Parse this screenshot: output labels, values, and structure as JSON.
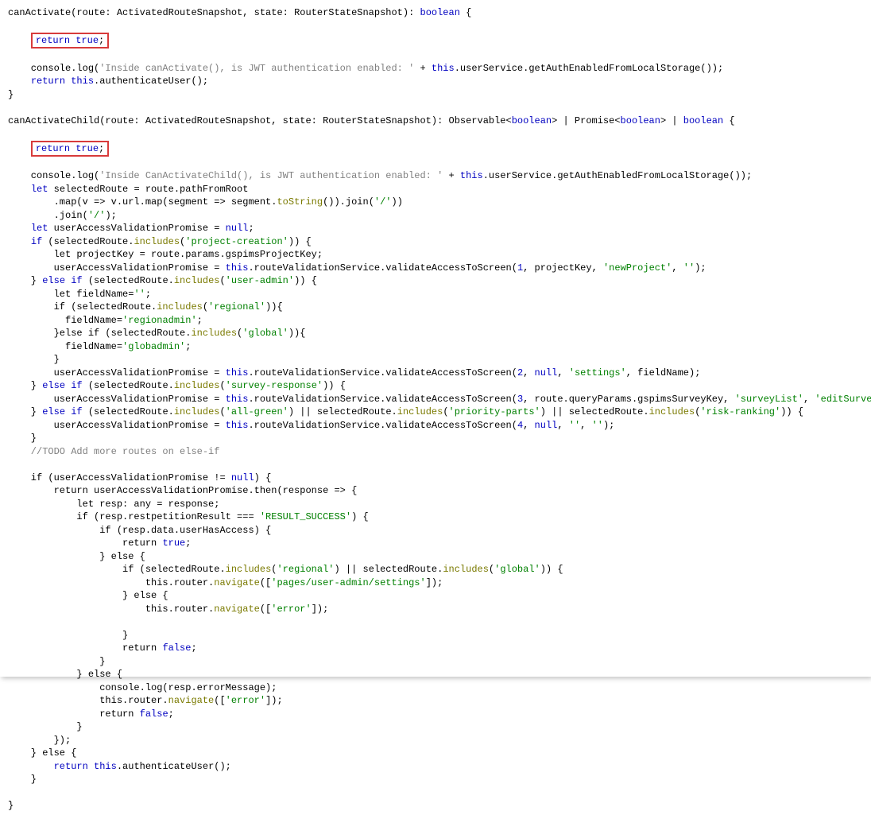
{
  "code": {
    "fn_canActivate_sig_name": "canActivate",
    "fn_canActivate_sig_rest": "(route: ActivatedRouteSnapshot, state: RouterStateSnapshot): ",
    "boolean_kw": "boolean",
    "open_brace": " {",
    "return_true_stmt": "return true;",
    "l_console1a": "    console.log(",
    "l_console1_str": "'Inside canActivate(), is JWT authentication enabled: '",
    "l_console1b": " + ",
    "this_kw": "this",
    "l_console1c": ".userService.getAuthEnabledFromLocalStorage());",
    "l_return_auth": "    return this.authenticateUser();",
    "close_brace": "}",
    "fn_canActivateChild_sig_name": "canActivateChild",
    "fn_canActivateChild_sig_rest": "(route: ActivatedRouteSnapshot, state: RouterStateSnapshot): Observable<",
    "gt_pipe_promise": "> | Promise<",
    "gt_pipe_boolean_brace": "> | ",
    "l_console2_str": "'Inside CanActivateChild(), is JWT authentication enabled: '",
    "let_kw": "let",
    "if_kw": "if",
    "else_kw": "else",
    "return_kw": "return",
    "true_kw": "true",
    "false_kw": "false",
    "null_kw": "null",
    "l_sel1": " selectedRoute = route.pathFromRoot",
    "l_sel2": "        .map(v => v.url.map(segment => segment.",
    "toString_fn": "toString",
    "l_sel2b": "()).join(",
    "slash_str": "'/'",
    "l_sel2c": "))",
    "l_sel3": "        .join(",
    "l_sel3b": ");",
    "l_uavp": " userAccessValidationPromise = ",
    "semicolon": ";",
    "l_if_sel": " (selectedRoute.",
    "includes_fn": "includes",
    "projectcreation_str": "'project-creation'",
    "close_if": ")) {",
    "l_projkey": "        let projectKey = route.params.gspimsProjectKey;",
    "l_uavp_assign": "        userAccessValidationPromise = ",
    "l_rvservice": ".routeValidationService.validateAccessToScreen(",
    "one": "1",
    "two": "2",
    "three": "3",
    "four": "4",
    "comma_spc": ", ",
    "projectkey_id": "projectKey",
    "newProject_str": "'newProject'",
    "emptystr": "''",
    "close_call": ");",
    "elseif_open": "    } ",
    "elseif_kw": "else if",
    "useradmin_str": "'user-admin'",
    "l_fieldName_decl": "        let fieldName=",
    "regional_str": "'regional'",
    "l_if_inner_open": "        if (selectedRoute.",
    "close_if2": ")){",
    "l_field_region": "          fieldName=",
    "regionadmin_str": "'regionadmin'",
    "l_elseif_inner": "        }else if (selectedRoute.",
    "global_str": "'global'",
    "globadmin_str": "'globadmin'",
    "l_closeinner": "        }",
    "settings_str": "'settings'",
    "fieldName_id": ", fieldName);",
    "surveyresponse_str": "'survey-response'",
    "l_survey_b": "route.queryParams.gspimsSurveyKey, ",
    "surveyList_str": "'surveyList'",
    "editSurvey_str": "'editSurvey'",
    "allgreen_str": "'all-green'",
    "priorityparts_str": "'priority-parts'",
    "riskranking_str": "'risk-ranking'",
    "pipe_or": " || selectedRoute.",
    "l_closeblock": "    }",
    "todo_comment": "    //TODO Add more routes on else-if",
    "l_if_uavp": "    if (userAccessValidationPromise != ",
    "close_brace_only": ") {",
    "l_return_uavp": "        return userAccessValidationPromise.then(response => {",
    "l_resp1": "            let resp: any = response;",
    "l_if_restpet": "            if (resp.restpetitionResult === ",
    "result_success_str": "'RESULT_SUCCESS'",
    "l_if_userhas": "                if (resp.data.userHasAccess) {",
    "l_return_true": "                    return ",
    "semi_only": ";",
    "l_else16": "                } else {",
    "l_if_reg_glob": "                    if (selectedRoute.",
    "close_paren_only": ")) {",
    "l_nav1": "                        this.router.",
    "navigate_fn": "navigate",
    "open_sq": "([",
    "pages_useradmin_str": "'pages/user-admin/settings'",
    "close_sq": "]);",
    "l_else20": "                    } else {",
    "error_str": "'error'",
    "l_close20": "                    }",
    "l_return_false": "                    return ",
    "l_close16": "                }",
    "l_else_outer": "            } else {",
    "l_consolelog_err": "                console.log(resp.errorMessage);",
    "l_nav_err": "                this.router.",
    "l_return_false2": "                return ",
    "l_close_outer": "            }",
    "l_close_then": "        });",
    "l_else_final": "    } else {",
    "l_return_auth2": "        return this.authenticateUser();",
    "l_close_final": "    }"
  }
}
